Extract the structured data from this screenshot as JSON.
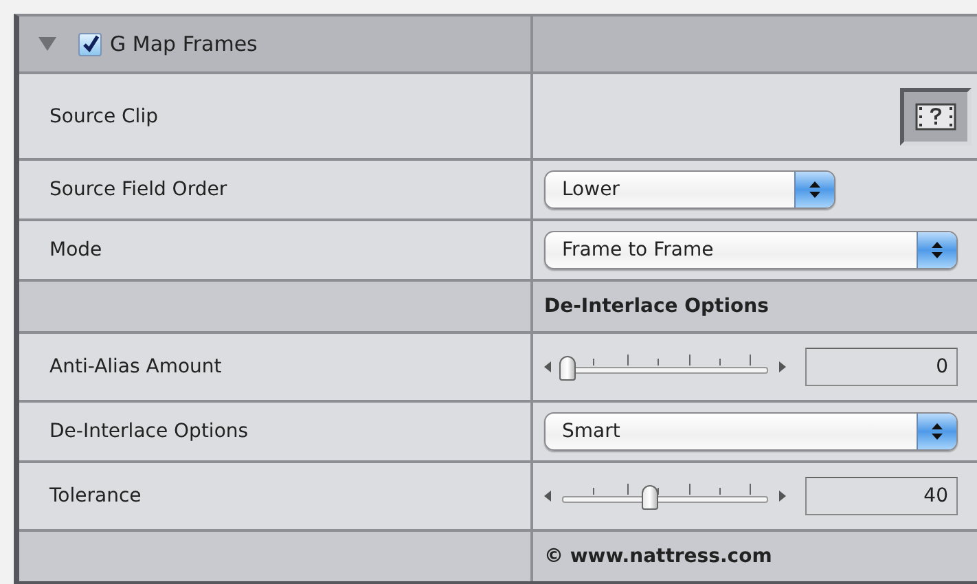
{
  "effect": {
    "title": "G Map Frames",
    "expanded": true,
    "enabled": true
  },
  "rows": [
    {
      "kind": "clip",
      "label": "Source Clip"
    },
    {
      "kind": "popup",
      "label": "Source Field Order",
      "value": "Lower",
      "compact": true
    },
    {
      "kind": "popup",
      "label": "Mode",
      "value": "Frame to Frame",
      "compact": false
    },
    {
      "kind": "section",
      "text": "De-Interlace Options"
    },
    {
      "kind": "slider",
      "label": "Anti-Alias Amount",
      "level": 0,
      "reading": "0"
    },
    {
      "kind": "popup",
      "label": "De-Interlace Options",
      "value": "Smart",
      "compact": false
    },
    {
      "kind": "slider",
      "label": "Tolerance",
      "level": 0.4,
      "reading": "40"
    },
    {
      "kind": "section",
      "text": "© www.nattress.com"
    }
  ]
}
